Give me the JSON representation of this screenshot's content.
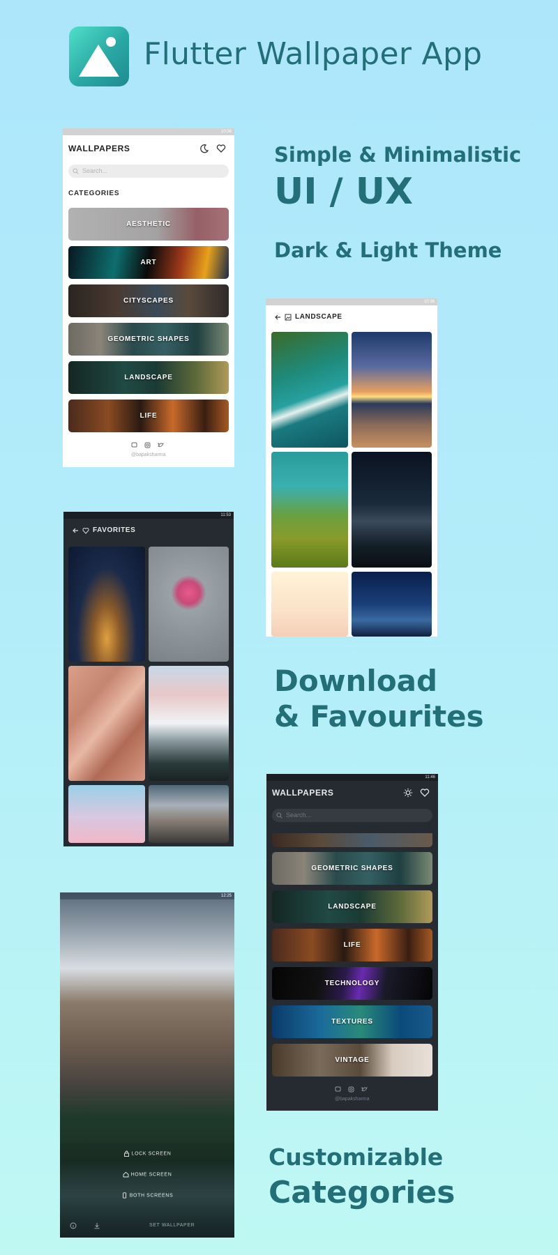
{
  "header": {
    "title": "Flutter Wallpaper App"
  },
  "features": {
    "line1": "Simple & Minimalistic",
    "line2": "UI / UX",
    "line3": "Dark & Light Theme",
    "download1": "Download",
    "download2": "& Favourites",
    "custom1": "Customizable",
    "custom2": "Categories"
  },
  "phone_home_light": {
    "status_time": "10:36",
    "title": "WALLPAPERS",
    "search_placeholder": "Search...",
    "section_label": "CATEGORIES",
    "categories": [
      "AESTHETIC",
      "ART",
      "CITYSCAPES",
      "GEOMETRIC SHAPES",
      "LANDSCAPE",
      "LIFE"
    ],
    "footer_handle": "@bapaksharma"
  },
  "phone_landscape": {
    "status_time": "10:36",
    "title": "LANDSCAPE"
  },
  "phone_favorites": {
    "status_time": "11:53",
    "title": "FAVORITES"
  },
  "phone_home_dark": {
    "status_time": "11:46",
    "title": "WALLPAPERS",
    "search_placeholder": "Search...",
    "categories": [
      "GEOMETRIC SHAPES",
      "LANDSCAPE",
      "LIFE",
      "TECHNOLOGY",
      "TEXTURES",
      "VINTAGE"
    ],
    "footer_handle": "@bapaksharma"
  },
  "phone_setwall": {
    "status_time": "12:25",
    "options": [
      "LOCK SCREEN",
      "HOME SCREEN",
      "BOTH SCREENS"
    ],
    "bottom_label": "SET WALLPAPER"
  },
  "colors": {
    "accent": "#236f77",
    "bg_top": "#ade6fb",
    "bg_bottom": "#bff8f3",
    "dark_ui": "#252b30"
  },
  "icons": [
    "app-logo-icon",
    "moon-icon",
    "heart-icon",
    "sun-icon",
    "search-icon",
    "back-arrow-icon",
    "image-icon",
    "discord-icon",
    "instagram-icon",
    "twitter-icon",
    "lock-icon",
    "home-icon",
    "phone-icon",
    "download-icon",
    "info-icon"
  ]
}
